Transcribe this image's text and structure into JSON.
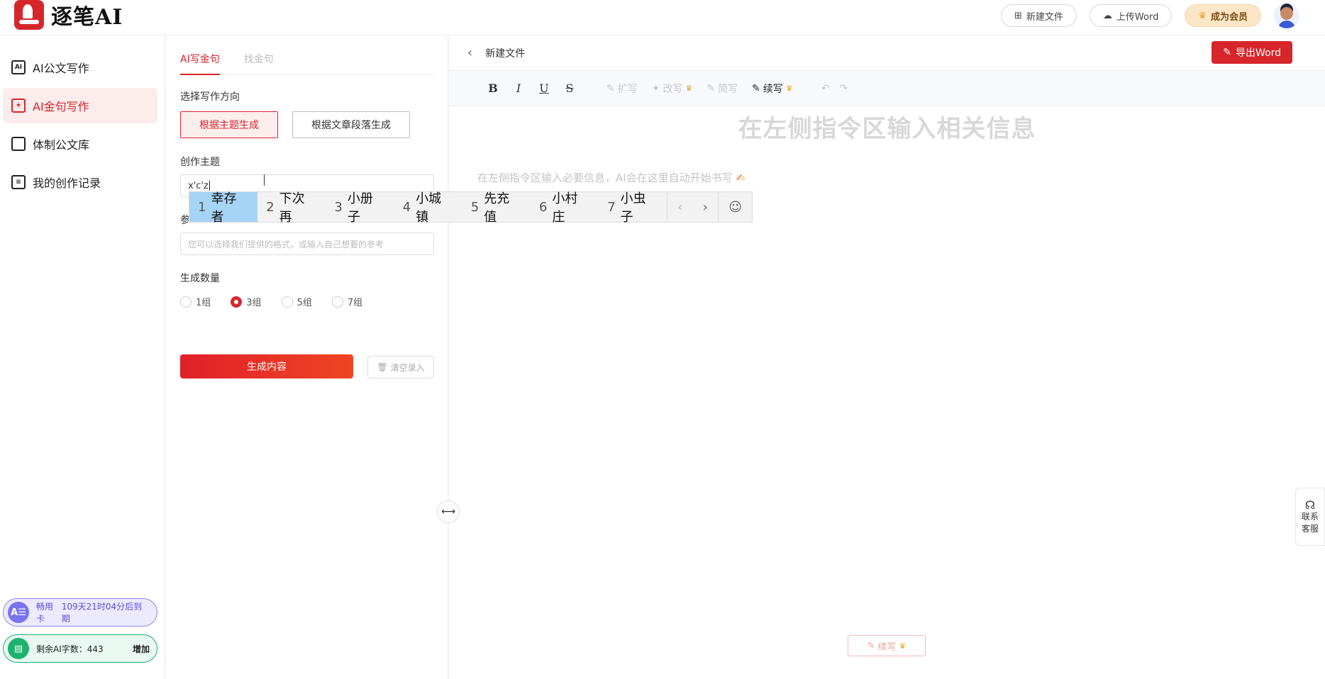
{
  "app": {
    "logo_text": "逐笔AI"
  },
  "header": {
    "new_file": "新建文件",
    "upload_word": "上传Word",
    "become_member": "成为会员"
  },
  "sidebar": {
    "items": [
      {
        "label": "AI公文写作",
        "icon": "ai-doc-icon"
      },
      {
        "label": "AI金句写作",
        "icon": "ai-quote-icon"
      },
      {
        "label": "体制公文库",
        "icon": "folder-icon"
      },
      {
        "label": "我的创作记录",
        "icon": "record-icon"
      }
    ],
    "vip_card": {
      "badge": "A☰",
      "label": "畅用卡",
      "expiry": "109天21时04分后到期"
    },
    "words_card": {
      "label": "剩余AI字数：443",
      "action": "增加"
    }
  },
  "panel": {
    "tabs": [
      "AI写金句",
      "找金句"
    ],
    "direction_label": "选择写作方向",
    "direction_options": [
      "根据主题生成",
      "根据文章段落生成"
    ],
    "topic_label": "创作主题",
    "topic_value": "x'c'z",
    "reference_label": "参",
    "reference_placeholder": "您可以选择我们提供的格式，或输入自己想要的参考",
    "count_label": "生成数量",
    "count_options": [
      "1组",
      "3组",
      "5组",
      "7组"
    ],
    "count_selected": "3组",
    "generate_button": "生成内容",
    "clear_button": "清空录入"
  },
  "editor": {
    "back_title": "新建文件",
    "export_button": "导出Word",
    "toolbar": {
      "bold": "B",
      "italic": "I",
      "underline": "U",
      "strike": "S",
      "expand": "扩写",
      "rewrite": "改写",
      "shorten": "简写",
      "continue": "续写"
    },
    "title_placeholder": "在左侧指令区输入相关信息",
    "hint": "在左侧指令区输入必要信息，AI会在这里自动开始书写",
    "float_continue": "续写"
  },
  "service": {
    "line1": "联系",
    "line2": "客服"
  },
  "ime": {
    "candidates": [
      {
        "num": "1",
        "text": "幸存者"
      },
      {
        "num": "2",
        "text": "下次再"
      },
      {
        "num": "3",
        "text": "小册子"
      },
      {
        "num": "4",
        "text": "小城镇"
      },
      {
        "num": "5",
        "text": "先充值"
      },
      {
        "num": "6",
        "text": "小村庄"
      },
      {
        "num": "7",
        "text": "小虫子"
      }
    ]
  },
  "colors": {
    "brand": "#d7262b",
    "vip": "#7b72f0",
    "green": "#1db36f"
  }
}
